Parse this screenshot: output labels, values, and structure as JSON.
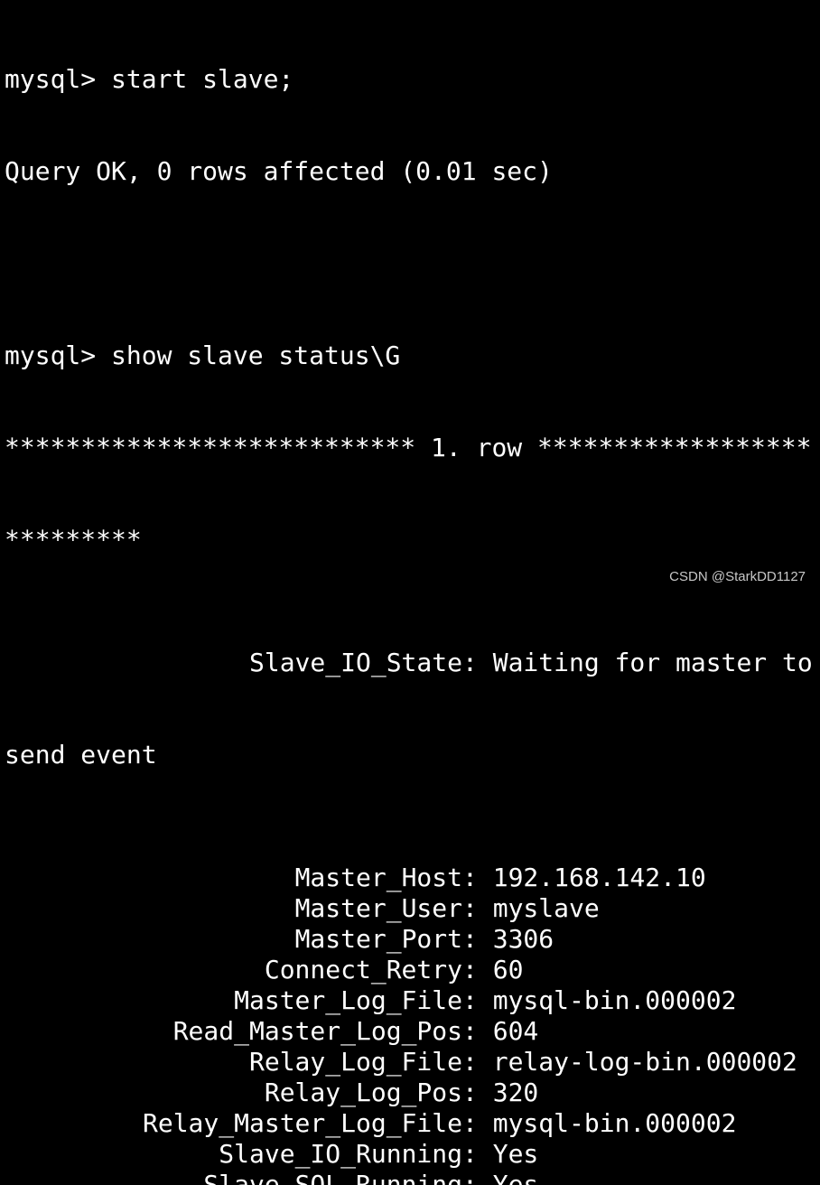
{
  "terminal": {
    "lines": [
      "mysql> start slave;",
      "Query OK, 0 rows affected (0.01 sec)",
      "",
      "mysql> show slave status\\G",
      "*************************** 1. row ******************",
      "*********"
    ],
    "slave_io_state": {
      "key": "Slave_IO_State",
      "value_part1": "Waiting for master to",
      "value_part2": "send event"
    },
    "fields": [
      {
        "key": "Master_Host",
        "value": "192.168.142.10"
      },
      {
        "key": "Master_User",
        "value": "myslave"
      },
      {
        "key": "Master_Port",
        "value": "3306"
      },
      {
        "key": "Connect_Retry",
        "value": "60"
      },
      {
        "key": "Master_Log_File",
        "value": "mysql-bin.000002"
      },
      {
        "key": "Read_Master_Log_Pos",
        "value": "604"
      },
      {
        "key": "Relay_Log_File",
        "value": "relay-log-bin.000002"
      },
      {
        "key": "Relay_Log_Pos",
        "value": "320"
      },
      {
        "key": "Relay_Master_Log_File",
        "value": "mysql-bin.000002"
      },
      {
        "key": "Slave_IO_Running",
        "value": "Yes"
      },
      {
        "key": "Slave_SQL_Running",
        "value": "Yes"
      }
    ],
    "separator": ": "
  },
  "watermark": "CSDN @StarkDD1127",
  "colors": {
    "background": "#000000",
    "text": "#ffffff",
    "watermark": "#c8c8c8"
  }
}
